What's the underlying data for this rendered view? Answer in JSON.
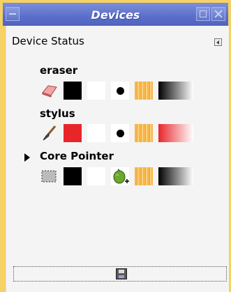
{
  "window": {
    "title": "Devices"
  },
  "panel": {
    "header": "Device Status"
  },
  "devices": [
    {
      "name": "eraser",
      "tool_icon": "eraser-icon",
      "foreground": "#000000",
      "background": "#ffffff",
      "brush": "circle-brush",
      "gradient_end": "#000000"
    },
    {
      "name": "stylus",
      "tool_icon": "paintbrush-icon",
      "foreground": "#e8262a",
      "background": "#ffffff",
      "brush": "circle-brush",
      "gradient_end": "#e8262a"
    },
    {
      "name": "Core Pointer",
      "tool_icon": "rect-select-icon",
      "foreground": "#000000",
      "background": "#ffffff",
      "brush": "pepper-brush",
      "gradient_end": "#000000",
      "current": true
    }
  ],
  "footer": {
    "save_icon": "floppy-save-icon"
  },
  "colors": {
    "titlebar": "#5a6fca",
    "frame": "#f6d163",
    "panel_bg": "#f4f4f4"
  }
}
